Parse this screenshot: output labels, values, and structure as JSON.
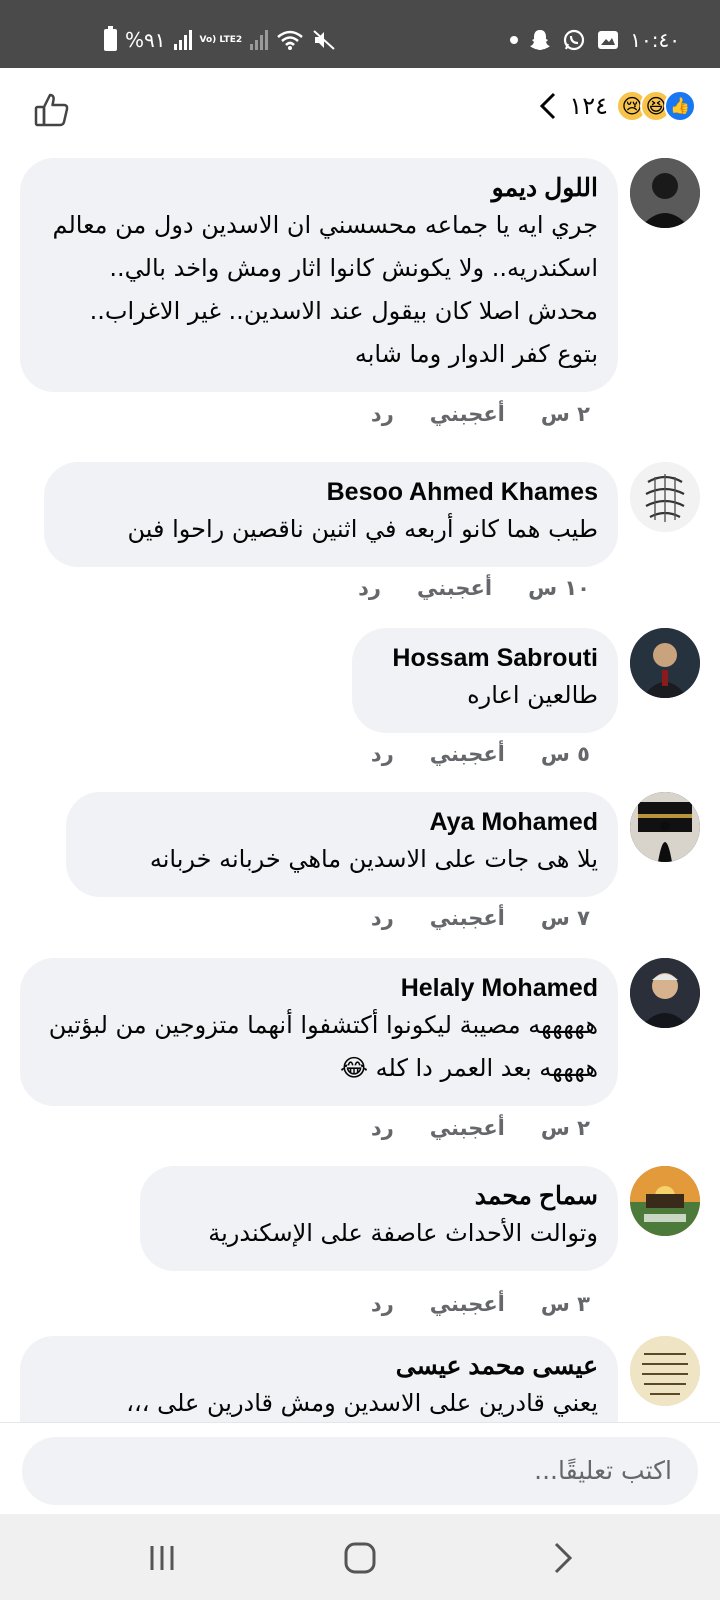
{
  "status_bar": {
    "time": "١٠:٤٠",
    "battery": "%٩١",
    "network": "Vo) LTE2",
    "icons": [
      "battery-icon",
      "signal-icon",
      "lte-icon",
      "signal-icon",
      "wifi-icon",
      "mute-icon",
      "dot-icon",
      "snapchat-icon",
      "whatsapp-icon",
      "gallery-icon"
    ]
  },
  "header": {
    "reaction_count": "١٢٤",
    "reaction_icons": [
      "like-reaction-icon",
      "haha-reaction-icon",
      "sad-reaction-icon"
    ]
  },
  "comments": [
    {
      "author": "اللول ديمو",
      "text": "جري ايه يا جماعه محسسني ان الاسدين دول من معالم اسكندريه.. ولا يكونش كانوا اثار ومش واخد بالي.. محدش اصلا كان بيقول عند الاسدين.. غير الاغراب.. بتوع كفر الدوار وما شابه",
      "time": "٢ س",
      "like": "أعجبني",
      "reply": "رد",
      "avatar_color": "#3a3a3a"
    },
    {
      "author": "Besoo Ahmed Khames",
      "text": "طيب هما كانو أربعه في اثنين ناقصين راحوا فين",
      "time": "١٠ س",
      "like": "أعجبني",
      "reply": "رد",
      "avatar_color": "#e8e8e8"
    },
    {
      "author": "Hossam Sabrouti",
      "text": "طالعين اعاره",
      "time": "٥ س",
      "like": "أعجبني",
      "reply": "رد",
      "avatar_color": "#2c3e50"
    },
    {
      "author": "Aya Mohamed",
      "text": "يلا هى جات على الاسدين ماهي خربانه خربانه",
      "time": "٧ س",
      "like": "أعجبني",
      "reply": "رد",
      "avatar_color": "#1c1c1c"
    },
    {
      "author": "Helaly Mohamed",
      "text": "هههههه مصيبة ليكونوا أكتشفوا أنهما متزوجين من لبؤتين ههههه  بعد العمر دا كله 😂",
      "time": "٢ س",
      "like": "أعجبني",
      "reply": "رد",
      "avatar_color": "#2b2b2b"
    },
    {
      "author": "سماح محمد",
      "text": "وتوالت الأحداث عاصفة على الإسكندرية",
      "time": "٣ س",
      "like": "أعجبني",
      "reply": "رد",
      "avatar_color": "#c96a2a"
    },
    {
      "author": "عيسى محمد عيسى",
      "text": "يعني قادرين على الاسدين ومش قادرين على ،،،",
      "time": "",
      "like": "",
      "reply": "",
      "avatar_color": "#e9dfc0"
    }
  ],
  "composer": {
    "placeholder": "اكتب تعليقًا..."
  },
  "navbar": {
    "icons": [
      "recent-apps-icon",
      "home-icon",
      "back-icon"
    ]
  },
  "colors": {
    "status_bar": "#4a4a4a",
    "bubble": "#f0f2f5",
    "meta_text": "#65676b",
    "like_blue": "#1877f2"
  }
}
